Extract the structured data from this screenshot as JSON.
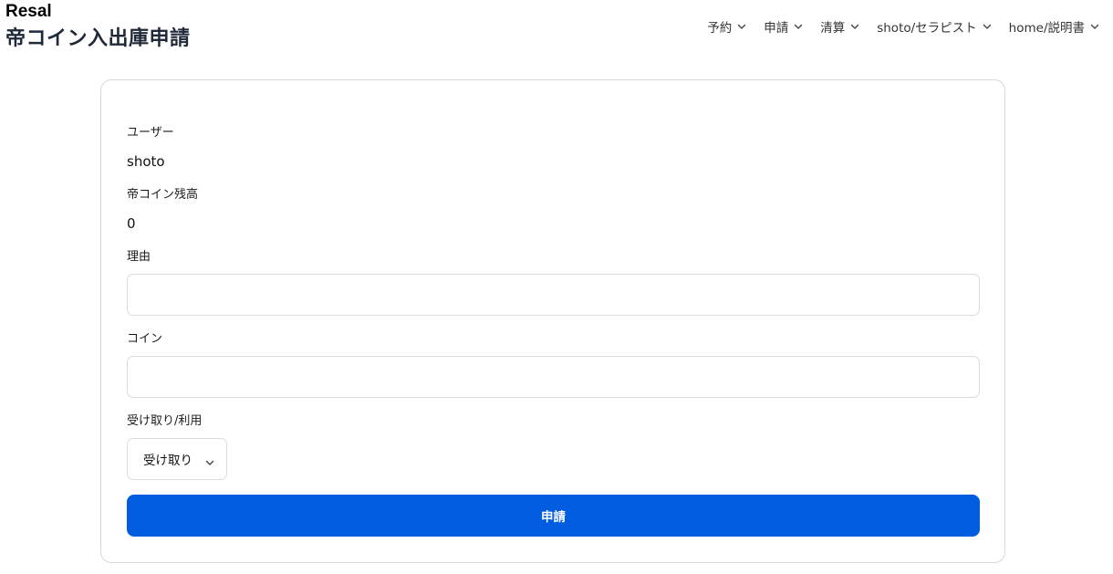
{
  "header": {
    "brand": "Resal",
    "title": "帝コイン入出庫申請"
  },
  "nav": {
    "items": [
      {
        "label": "予約"
      },
      {
        "label": "申請"
      },
      {
        "label": "清算"
      },
      {
        "label": "shoto/セラピスト"
      },
      {
        "label": "home/説明書"
      }
    ],
    "chevron_icon": "chevron-down-icon"
  },
  "form": {
    "user_label": "ユーザー",
    "user_value": "shoto",
    "balance_label": "帝コイン残高",
    "balance_value": "0",
    "reason_label": "理由",
    "reason_value": "",
    "coin_label": "コイン",
    "coin_value": "",
    "type_label": "受け取り/利用",
    "type_selected": "受け取り",
    "submit_label": "申請"
  },
  "colors": {
    "primary": "#005ddf",
    "border": "#dcdcdc"
  }
}
